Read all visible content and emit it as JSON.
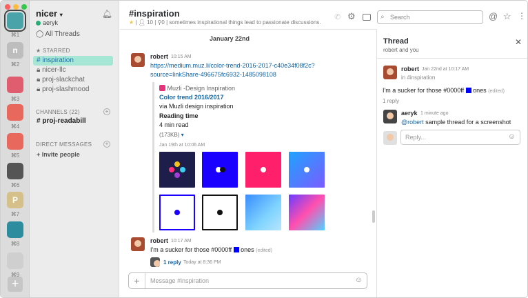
{
  "window": {
    "traffic_colors": [
      "#fc605c",
      "#fdbc40",
      "#34c84a"
    ]
  },
  "teams": [
    {
      "letter": "",
      "key": "⌘1",
      "color": "#4aa3a8"
    },
    {
      "letter": "n",
      "key": "⌘2",
      "color": "#bdbdbd"
    },
    {
      "letter": "",
      "key": "⌘3",
      "color": "#e05d6f"
    },
    {
      "letter": "",
      "key": "⌘4",
      "color": "#e8685d"
    },
    {
      "letter": "",
      "key": "⌘5",
      "color": "#e8685d"
    },
    {
      "letter": "",
      "key": "⌘6",
      "color": "#555555"
    },
    {
      "letter": "P",
      "key": "⌘7",
      "color": "#d6c08a"
    },
    {
      "letter": "",
      "key": "⌘8",
      "color": "#2d8c9e"
    },
    {
      "letter": "",
      "key": "⌘9",
      "color": "#cfcfcf"
    }
  ],
  "sidebar": {
    "workspace": "nicer",
    "user": "aeryk",
    "all_threads": "All Threads",
    "starred_label": "STARRED",
    "starred": [
      "inspiration",
      "nicer-llc",
      "proj-slackchat",
      "proj-slashmood"
    ],
    "channels_label": "CHANNELS",
    "channels_count": "(22)",
    "channels": [
      "proj-readabill"
    ],
    "dm_label": "DIRECT MESSAGES",
    "invite": "Invite people"
  },
  "header": {
    "channel": "#inspiration",
    "members": "10",
    "pins": "0",
    "topic": "sometimes inspirational things lead to passionate discussions.",
    "search_placeholder": "Search"
  },
  "messages": {
    "date": "January 22nd",
    "m1_user": "robert",
    "m1_time": "10:15 AM",
    "m1_link1": "https://medium.muz.li/color-trend-2016-2017-c40e34f08f2c?",
    "m1_link2": "source=linkShare-496675fc6932-1485098108",
    "att_source": "Muzli -Design Inspiration",
    "att_title": "Color trend 2016/2017",
    "att_via": "via Muzli design inspiration",
    "att_reading_label": "Reading time",
    "att_reading": "4 min read",
    "att_size": "(173KB)",
    "att_date": "Jan 19th at 10:06 AM",
    "m2_user": "robert",
    "m2_time": "10:17 AM",
    "m2_text_a": "I'm a sucker for those #0000ff",
    "m2_text_b": "ones",
    "m2_edited": "(edited)",
    "m2_replies": "1 reply",
    "m2_reply_time": "Today at 8:36 PM",
    "composer_placeholder": "Message #inspiration"
  },
  "thread": {
    "title": "Thread",
    "subtitle": "robert and you",
    "parent_user": "robert",
    "parent_time": "Jan 22nd at 10:17 AM",
    "parent_channel": "in #inspiration",
    "parent_text_a": "I'm a sucker for those #0000ff",
    "parent_text_b": "ones",
    "parent_edited": "(edited)",
    "reply_count": "1 reply",
    "reply_user": "aeryk",
    "reply_time": "1 minute ago",
    "reply_mention": "@robert",
    "reply_text": "sample thread for a screenshot",
    "reply_placeholder": "Reply..."
  }
}
